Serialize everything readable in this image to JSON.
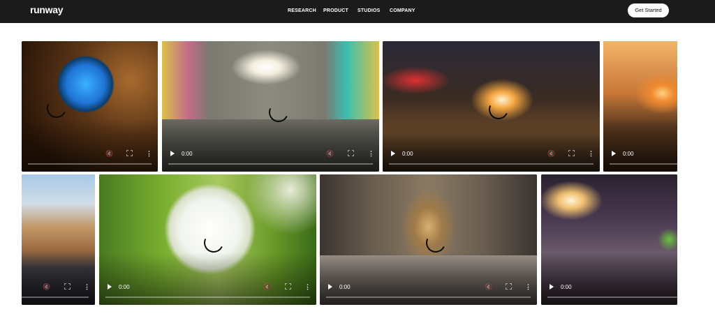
{
  "header": {
    "logo": "runway",
    "nav": [
      "RESEARCH",
      "PRODUCT",
      "STUDIOS",
      "COMPANY"
    ],
    "cta": "Get Started"
  },
  "video": {
    "time": "0:00",
    "mute_symbol": "🔇",
    "more_symbol": "⋮"
  },
  "colors": {
    "nav_bg": "#1b1b1b",
    "page_bg": "#ffffff"
  }
}
